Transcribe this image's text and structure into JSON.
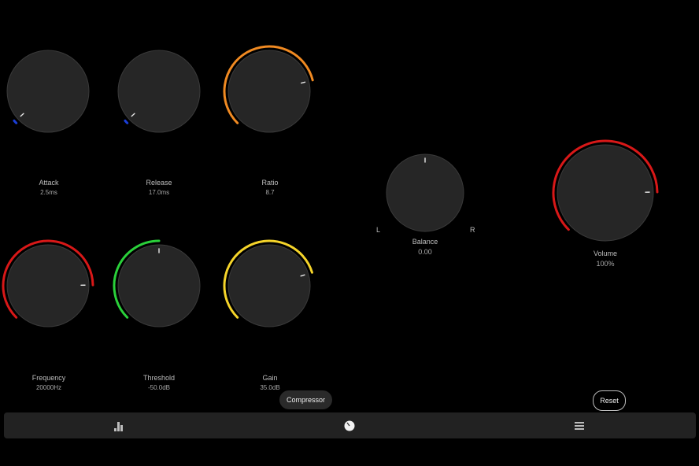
{
  "knobs": [
    {
      "id": "attack",
      "label": "Attack",
      "value": "2.5ms",
      "level": 0.01,
      "color": "#1a3ed8"
    },
    {
      "id": "release",
      "label": "Release",
      "value": "17.0ms",
      "level": 0.01,
      "color": "#1a3ed8"
    },
    {
      "id": "ratio",
      "label": "Ratio",
      "value": "8.7",
      "level": 0.78,
      "color": "#f08a22"
    },
    {
      "id": "frequency",
      "label": "Frequency",
      "value": "20000Hz",
      "level": 0.83,
      "color": "#d81818"
    },
    {
      "id": "threshold",
      "label": "Threshold",
      "value": "-50.0dB",
      "level": 0.5,
      "color": "#2ad03a"
    },
    {
      "id": "gain",
      "label": "Gain",
      "value": "35.0dB",
      "level": 0.77,
      "color": "#f5d42a"
    }
  ],
  "balance": {
    "label": "Balance",
    "value": "0.00",
    "left": "L",
    "right": "R",
    "level": 0.5
  },
  "volume": {
    "label": "Volume",
    "value": "100%",
    "level": 0.83,
    "color": "#d81818"
  },
  "buttons": {
    "compressor": "Compressor",
    "reset": "Reset"
  },
  "nav": [
    "chart-bars-icon",
    "knob-icon",
    "menu-icon"
  ]
}
